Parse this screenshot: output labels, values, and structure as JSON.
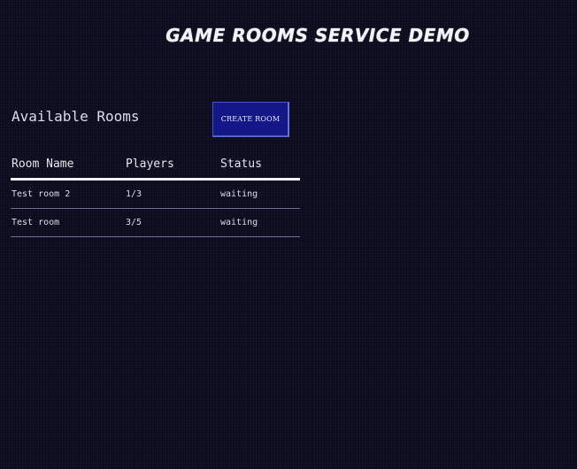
{
  "header": {
    "title": "GAME ROOMS SERVICE DEMO"
  },
  "rooms_panel": {
    "title": "Available Rooms",
    "create_button_label": "CREATE ROOM"
  },
  "table": {
    "columns": [
      "Room Name",
      "Players",
      "Status"
    ],
    "rows": [
      {
        "name": "Test room 2",
        "players": "1/3",
        "status": "waiting"
      },
      {
        "name": "Test room",
        "players": "3/5",
        "status": "waiting"
      }
    ]
  },
  "colors": {
    "background": "#0a0b1d",
    "button": "#131788",
    "text": "#e6e6ec"
  }
}
